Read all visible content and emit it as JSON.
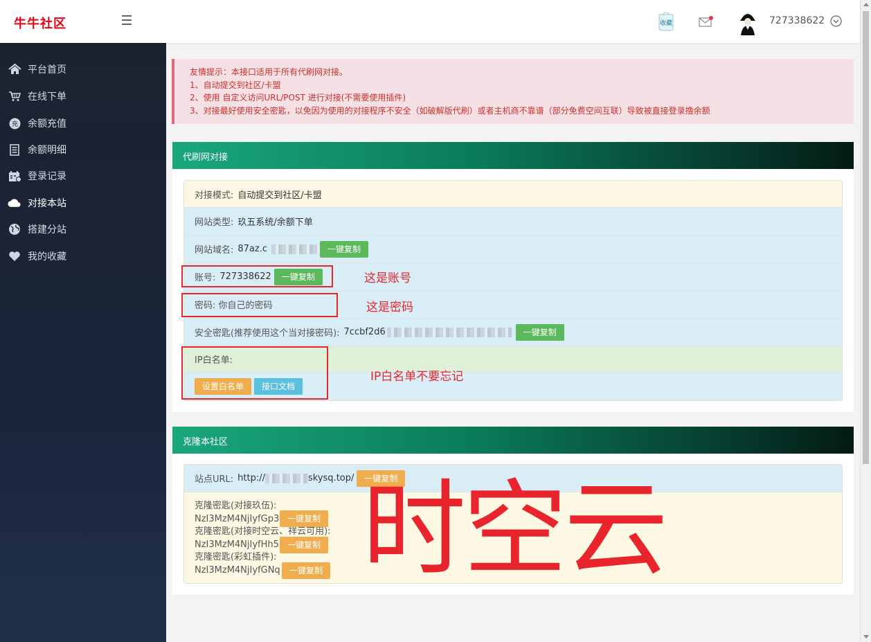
{
  "brand": "牛牛社区",
  "header": {
    "username": "727338622",
    "fav_icon_text": "收藏"
  },
  "sidebar": {
    "items": [
      {
        "label": "平台首页",
        "icon": "home-icon"
      },
      {
        "label": "在线下单",
        "icon": "cart-icon"
      },
      {
        "label": "余额充值",
        "icon": "recharge-icon"
      },
      {
        "label": "余额明细",
        "icon": "ledger-icon"
      },
      {
        "label": "登录记录",
        "icon": "login-record-icon"
      },
      {
        "label": "对接本站",
        "icon": "cloud-icon"
      },
      {
        "label": "搭建分站",
        "icon": "globe-icon"
      },
      {
        "label": "我的收藏",
        "icon": "heart-icon"
      }
    ]
  },
  "alert": {
    "lines": [
      "友情提示：本接口适用于所有代刷网对接。",
      "1、自动提交到社区/卡盟",
      "2、使用 自定义访问URL/POST 进行对接(不需要使用插件)",
      "3、对接最好使用安全密匙，以免因为使用的对接程序不安全（如破解版代刷）或者主机商不靠谱（部分免费空间互联）导致被直接登录撸余额"
    ]
  },
  "dock_panel": {
    "title": "代刷网对接",
    "mode_label": "对接模式:",
    "mode_value": "自动提交到社区/卡盟",
    "type_label": "网站类型:",
    "type_value": "玖五系统/余额下单",
    "domain_label": "网站域名:",
    "domain_value": "87az.c",
    "account_label": "账号:",
    "account_value": "727338622",
    "password_text": "密码: 你自己的密码",
    "secret_label": "安全密匙(推荐使用这个当对接密码):",
    "secret_value": "7ccbf2d6",
    "ip_label": "IP白名单:",
    "copy_label": "一键复制",
    "set_whitelist": "设置白名单",
    "api_docs": "接口文档"
  },
  "clone_panel": {
    "title": "克隆本社区",
    "url_label": "站点URL:",
    "url_prefix": "http://",
    "url_suffix": "skysq.top/",
    "copy_label": "一键复制",
    "key1_label": "克隆密匙(对接玖伍):",
    "key1_value": "NzI3MzM4NjIyfGp3",
    "key2_label": "克隆密匙(对接时空云、祥云可用):",
    "key2_value": "NzI3MzM4NjIyfHh5",
    "key3_label": "克隆密匙(彩虹插件):",
    "key3_value": "NzI3MzM4NjIyfGNq"
  },
  "annotations": {
    "account": "这是账号",
    "password": "这是密码",
    "ip": "IP白名单不要忘记",
    "watermark": "时空云"
  },
  "colors": {
    "brand": "#e60012",
    "annotation": "#e8252c",
    "copy_green": "#5cb85c",
    "copy_orange": "#f0ad4e"
  }
}
